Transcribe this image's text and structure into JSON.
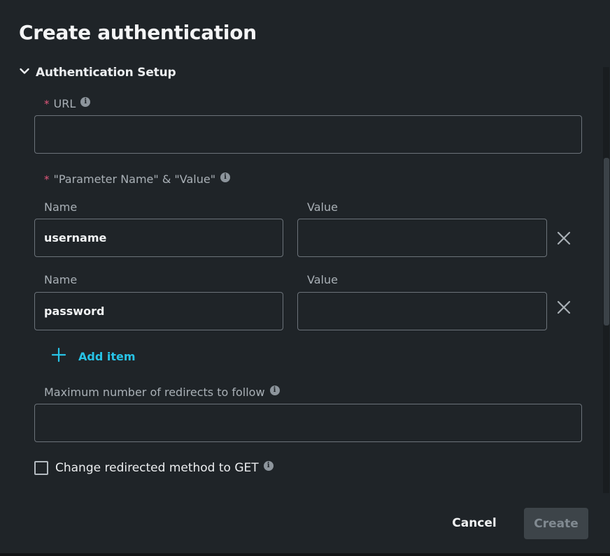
{
  "dialog": {
    "title": "Create authentication",
    "section_title": "Authentication Setup"
  },
  "url_field": {
    "label": "URL",
    "required_mark": "*",
    "info": "i",
    "value": ""
  },
  "params": {
    "label": "\"Parameter Name\" & \"Value\"",
    "required_mark": "*",
    "info": "i",
    "rows": [
      {
        "name_label": "Name",
        "value_label": "Value",
        "name": "username",
        "value": ""
      },
      {
        "name_label": "Name",
        "value_label": "Value",
        "name": "password",
        "value": ""
      }
    ],
    "add_item_label": "Add item"
  },
  "redirects_field": {
    "label": "Maximum number of redirects to follow",
    "info": "i",
    "value": ""
  },
  "redirect_method": {
    "label": "Change redirected method to GET",
    "info": "i",
    "checked": false
  },
  "footer": {
    "cancel_label": "Cancel",
    "create_label": "Create"
  },
  "colors": {
    "background": "#1f2428",
    "accent": "#27c3e6",
    "required": "#e0567a",
    "disabled_button": "#3d4449"
  },
  "icons": {
    "section_toggle": "chevron-down-icon",
    "info": "info-icon",
    "remove": "close-icon",
    "add": "plus-icon"
  }
}
